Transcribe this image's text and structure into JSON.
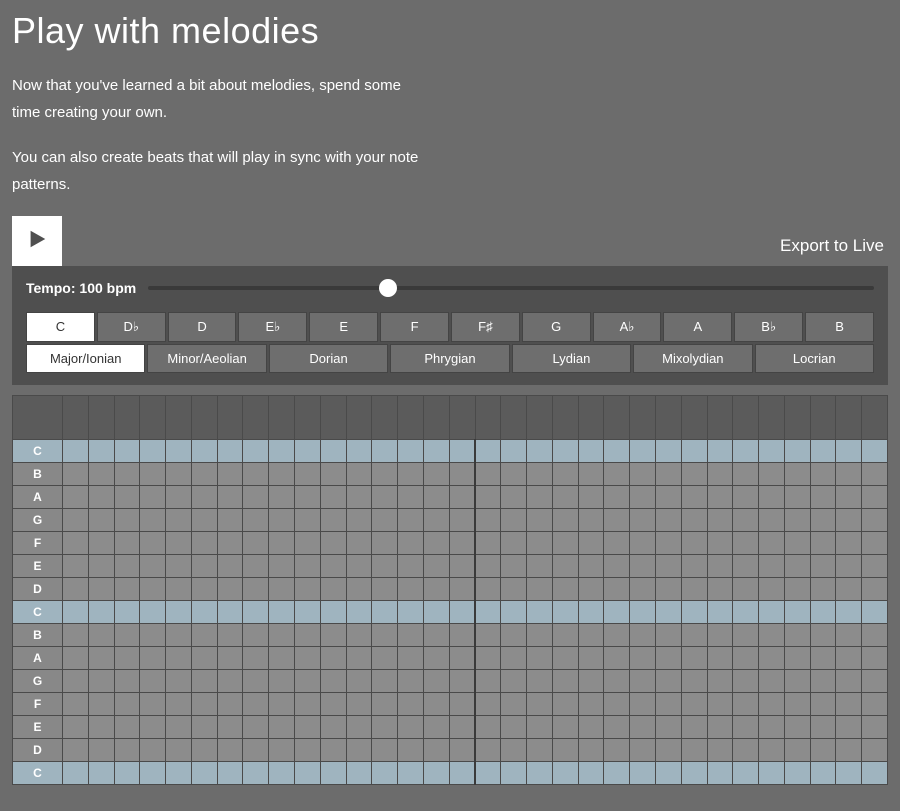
{
  "title": "Play with melodies",
  "intro": {
    "p1": "Now that you've learned a bit about melodies, spend some time creating your own.",
    "p2": "You can also create beats that will play in sync with your note patterns."
  },
  "toolbar": {
    "export_label": "Export to Live"
  },
  "tempo": {
    "label": "Tempo: 100 bpm",
    "value": 100,
    "percent": 33
  },
  "keys": [
    "C",
    "D♭",
    "D",
    "E♭",
    "E",
    "F",
    "F♯",
    "G",
    "A♭",
    "A",
    "B♭",
    "B"
  ],
  "selected_key_index": 0,
  "modes": [
    "Major/Ionian",
    "Minor/Aeolian",
    "Dorian",
    "Phrygian",
    "Lydian",
    "Mixolydian",
    "Locrian"
  ],
  "selected_mode_index": 0,
  "grid": {
    "rows": [
      "C",
      "B",
      "A",
      "G",
      "F",
      "E",
      "D",
      "C",
      "B",
      "A",
      "G",
      "F",
      "E",
      "D",
      "C"
    ],
    "tonic_indices": [
      0,
      7,
      14
    ],
    "columns": 32,
    "major_division": 16
  }
}
